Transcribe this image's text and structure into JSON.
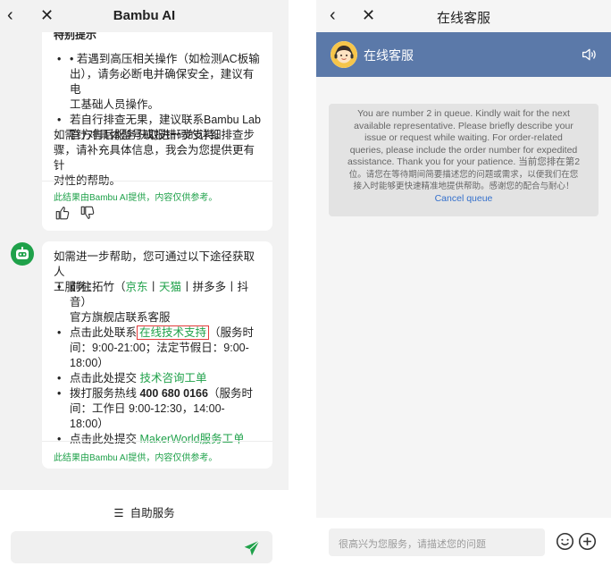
{
  "left": {
    "header": {
      "back_glyph": "‹",
      "close_glyph": "✕",
      "title": "Bambu AI"
    },
    "msg1": {
      "partial_heading": "特别提示",
      "bullets": [
        [
          "• 若遇到高压相关操作（如检测AC板输",
          "出），请务必断电并确保安全，建议有电",
          "工基础人员操作。"
        ],
        [
          "若自行排查无果，建议联系Bambu Lab",
          "官方售后服务获取进一步支持。"
        ]
      ],
      "paragraph": [
        "如需针对具体型号或报错码的详细排查步",
        "骤，请补充具体信息，我会为您提供更有针",
        "对性的帮助。"
      ],
      "disclaimer": "此结果由Bambu AI提供，内容仅供参考。"
    },
    "msg2": {
      "intro": [
        "如需进一步帮助，您可通过以下途径获取人",
        "工服务："
      ],
      "b1": {
        "prefix": "前往拓竹（",
        "jd": "京东",
        "sep1": "丨",
        "tmall": "天猫",
        "rest": "丨拼多多丨抖音）",
        "line2": "官方旗舰店联系客服"
      },
      "b2": {
        "prefix": "点击此处联系",
        "link": "在线技术支持",
        "suffix": "（服务时",
        "line2": "间：9:00-21:00；法定节假日：9:00-",
        "line3": "18:00）"
      },
      "b3": {
        "prefix": "点击此处提交 ",
        "link": "技术咨询工单"
      },
      "b4": {
        "prefix": "拨打服务热线 ",
        "hotline": "400 680 0166",
        "suffix": "（服务时",
        "line2": "间：工作日 9:00-12:30，14:00-",
        "line3": "18:00）"
      },
      "b5": {
        "prefix": "点击此处提交 ",
        "link": "MakerWorld服务工单"
      },
      "disclaimer": "此结果由Bambu AI提供，内容仅供参考。"
    },
    "bottom": {
      "menu_glyph": "☰",
      "self_service": "自助服务"
    }
  },
  "right": {
    "header": {
      "back_glyph": "‹",
      "close_glyph": "✕",
      "title": "在线客服"
    },
    "bar": {
      "agent_name": "在线客服"
    },
    "queue": {
      "lines_en": [
        "You are number 2 in queue. Kindly wait for the next",
        "available representative. Please briefly describe your",
        "issue or request while waiting. For order-related",
        "queries, please include the order number for expedited",
        "assistance. Thank you for your patience. 当前您排在第2"
      ],
      "lines_cn": [
        "位。请您在等待期间简要描述您的问题或需求，以便我们在您",
        "接入时能够更快速精准地提供帮助。感谢您的配合与耐心！"
      ],
      "cancel": "Cancel queue"
    },
    "input": {
      "placeholder": "很高兴为您服务，请描述您的问题"
    }
  },
  "colors": {
    "brand_green": "#1fa14a",
    "bar_blue": "#5b79a9",
    "link_blue": "#3470cc",
    "highlight_red": "#e23b3b"
  },
  "icons": [
    "back-icon",
    "close-icon",
    "thumbs-up-icon",
    "thumbs-down-icon",
    "bot-avatar-icon",
    "menu-icon",
    "send-icon",
    "agent-avatar-icon",
    "speaker-icon",
    "emoji-icon",
    "plus-icon"
  ]
}
